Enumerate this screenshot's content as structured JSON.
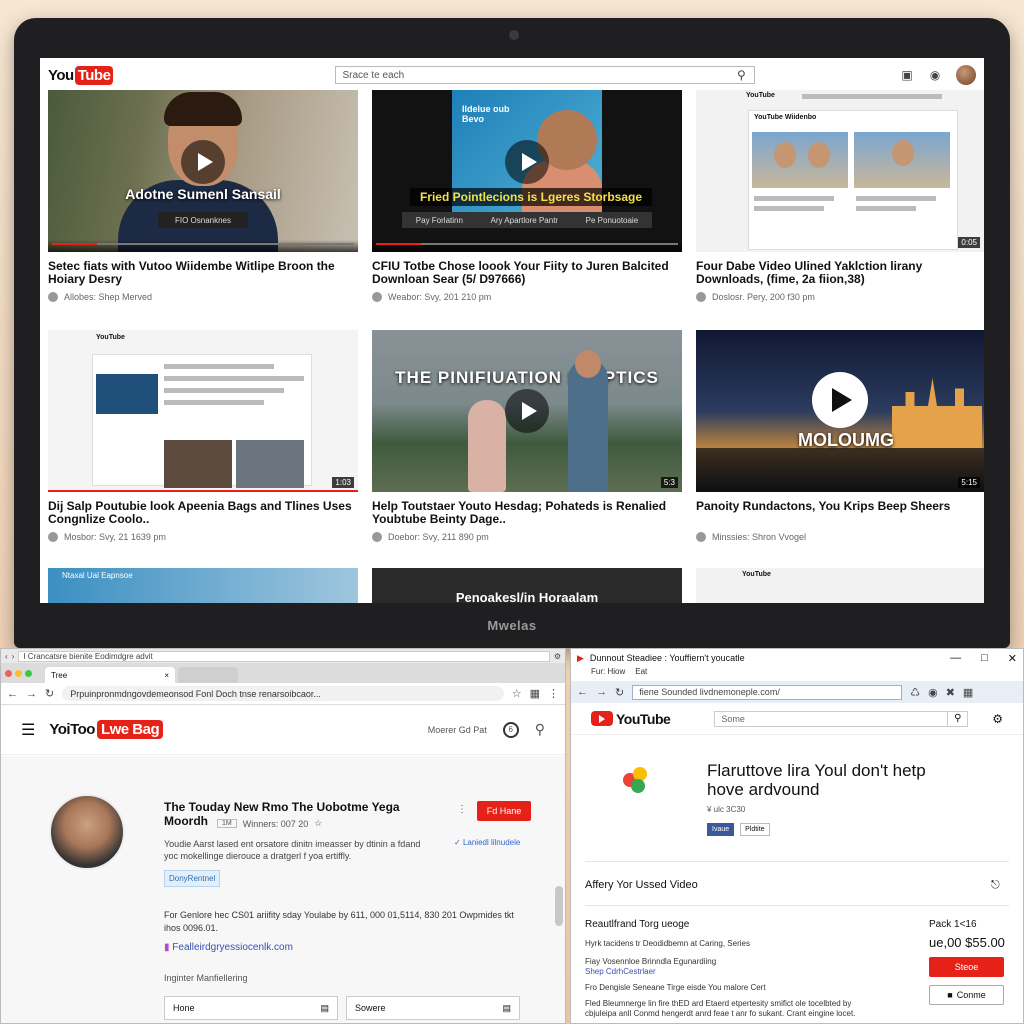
{
  "laptop": {
    "brand": "Mwelas",
    "youtube": {
      "logo_you": "You",
      "logo_tube": "Tube",
      "search_placeholder": "Srace te each",
      "videos": [
        {
          "title": "Setec fiats with Vutoo Wiidembe Witlipe Broon the Hoiary Desry",
          "meta": "Allobes: Shep Merved",
          "overlay": "Adotne Sumenl Sansail",
          "overlay_btn": "FIO Osnanknes",
          "duration": ""
        },
        {
          "title": "CFIU Totbe Chose loook Your Fiity to Juren Balcited Downloan Sear (5/ D97666)",
          "meta": "Weabor: Svy, 201 210 pm",
          "overlay": "Fried Pointlecions is Lgeres Storbsage",
          "overlay_panel": "Ildelue oub Bevo",
          "chips": [
            "Pay Forlatinn",
            "Ary Apartlore Pantr",
            "Pe Ponuotoaie"
          ],
          "duration": ""
        },
        {
          "title": "Four Dabe Video Ulined Yaklction lirany Downloads, (fime, 2a fiion,38)",
          "meta": "Doslosr. Pery, 200 f30 pm",
          "mini_logo": "YouTube",
          "mini_heading": "YouTube Wiidenbo",
          "duration": "0:05"
        },
        {
          "title": "Dij Salp Poutubie look Apeenia Bags and Tlines Uses Congnlize Coolo..",
          "meta": "Mosbor: Svy, 21 1639 pm",
          "mini_logo": "YouTube",
          "duration": "1:03"
        },
        {
          "title": "Help Toutstaer Youto Hesdag; Pohateds is Renalied Youbtube Beinty Dage..",
          "meta": "Doebor: Svy, 211 890 pm",
          "overlay": "THE PINIFIUATION STEPTICS",
          "duration": "5:3"
        },
        {
          "title": "Panoity Rundactons, You Krips Beep Sheers",
          "meta": "Minssies: Shron Vvogel",
          "overlay": "MOLOUMG",
          "duration": "5:15"
        }
      ],
      "row3": [
        {
          "label": "Ntaxal Ual Eapnsoe"
        },
        {
          "label": "Penoakesl/in Horaalam"
        },
        {
          "label": "YouTube"
        }
      ]
    }
  },
  "left_window": {
    "outer_url": "I Crancatsre bienite Eodimdgre advit",
    "tab_label": "Tree",
    "nav_url": "Prpuinpronmdngovdemeonsod Fonl Doch tnse renarsoibcaor...",
    "logo_main": "YoiToo",
    "logo_red": "Lwe Bag",
    "header_text": "Moerer Gd Pat",
    "channel": {
      "title": "The Touday New Rmo The Uobotme Yega Moordh",
      "chip": "1M",
      "sub_meta": "Winners: 007 20",
      "subscribe": "Fd Hane",
      "desc": "Youdie Aarst lased ent orsatore dinitn imeasser by dtinin a fdand yoc mokellinge dierouce a dratgerl f yoa ertiffly.",
      "link": "Laniedl lilnudele",
      "tag": "DonyRentnel",
      "info": "For Genlore hec CS01 ariifity sday Youlabe by 611, 000 01,5114, 830 201 Owpmides tkt ihos 0096.01.",
      "url": "Fealleirdgryessiocenlk.com",
      "register": "Inginter Manfiellering",
      "boxes": [
        "Hone",
        "Sowere"
      ]
    }
  },
  "right_window": {
    "title": "Dunnout Steadiee : Youffiern't youcatle",
    "menu": [
      "Fur: Hiow",
      "Eat"
    ],
    "nav_url": "fiene Sounded livdnemoneple.com/",
    "logo": "YouTube",
    "search_placeholder": "Some",
    "error_title": "Flaruttove lira Youl don't hetp hove ardvound",
    "error_sub": "¥ ulc 3C30",
    "share_buttons": [
      "Ivaue",
      "Pldtite"
    ],
    "section_title": "Affery Yor Ussed Video",
    "order_title": "Reautlfrand Torg ueoge",
    "lines": [
      "Hyrk tacidens tr Deodidbemn at Caring, Series",
      "Fiay Vosennloe Brinndla Egunardiing",
      "Shep CdrhCestrlaer",
      "Fro Dengisle Seneane Tirge eisde You malore Cert",
      "Fled Bleumnerge lin fire thED ard Etaerd etpertesity smifict ole tocelbted by",
      "cbjuleipa anll Conmd hengerdt anrd feae t anr fo sukant. Crant eingine locet."
    ],
    "pack": "Pack 1<16",
    "price": "ue,00 $55.00",
    "primary_btn": "Steoe",
    "secondary_btn": "Conme"
  },
  "colors": {
    "youtube_red": "#e62117",
    "link_blue": "#3366cc"
  }
}
